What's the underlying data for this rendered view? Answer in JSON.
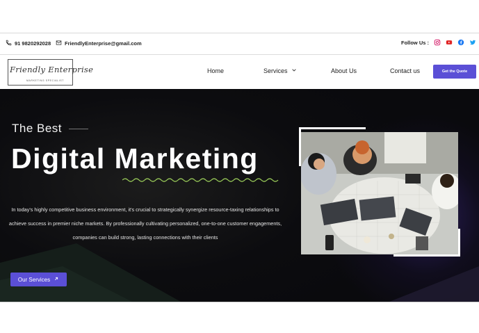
{
  "topbar": {
    "phone": "91 9820292028",
    "email": "FriendlyEnterprise@gmail.com",
    "follow_label": "Follow Us :",
    "social_icons": [
      "instagram-icon",
      "youtube-icon",
      "facebook-icon",
      "twitter-icon"
    ]
  },
  "logo": {
    "script_text": "Friendly Enterprise",
    "tagline": "MARKETING SPECIALIST"
  },
  "nav": {
    "items": [
      {
        "label": "Home"
      },
      {
        "label": "Services"
      },
      {
        "label": "About Us"
      },
      {
        "label": "Contact us"
      }
    ],
    "cta_label": "Get the Quote"
  },
  "hero": {
    "eyebrow": "The Best",
    "title": "Digital Marketing",
    "description": "In today's highly competitive business environment, it's crucial to strategically synergize resource-taxing relationships to achieve success in premier niche markets. By professionally cultivating personalized, one-to-one customer engagements, companies can build strong, lasting connections with their clients",
    "button_label": "Our Services"
  },
  "colors": {
    "accent": "#5b4fd6",
    "hero_bg": "#0c0c0f",
    "wave": "#9ccf5a",
    "slider_dot": "#7b6ff0"
  }
}
